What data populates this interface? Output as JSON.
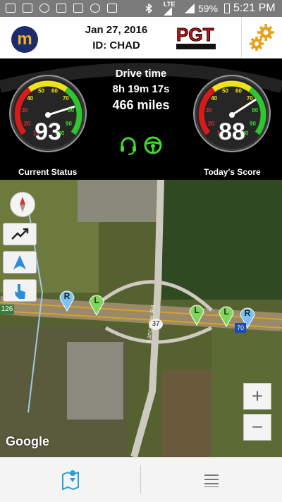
{
  "status_bar": {
    "lte": "LTE",
    "battery": "59%",
    "time": "5:21 PM"
  },
  "header": {
    "logo_letter": "m",
    "date": "Jan 27, 2016",
    "driver_id": "ID: CHAD",
    "brand_text": "PGT"
  },
  "dashboard": {
    "current_status": {
      "label": "Current Status",
      "value": "93",
      "scale": [
        "10",
        "20",
        "30",
        "40",
        "50",
        "60",
        "70",
        "80",
        "90",
        "100"
      ]
    },
    "todays_score": {
      "label": "Today's Score",
      "value": "88",
      "scale": [
        "10",
        "20",
        "30",
        "40",
        "50",
        "60",
        "70",
        "80",
        "90",
        "100"
      ]
    },
    "drive_time_label": "Drive time",
    "drive_time": "8h 19m 17s",
    "miles": "466 miles",
    "icons": [
      "headset-icon",
      "steering-wheel-icon"
    ],
    "accent": "#3ddc2b"
  },
  "map": {
    "attribution": "Google",
    "road_shields": {
      "left": "126",
      "center": "37",
      "interstate": "70"
    },
    "street_label": "Lancaster Rd",
    "markers": [
      "R",
      "L",
      "L",
      "L",
      "R"
    ],
    "zoom_in": "+",
    "zoom_out": "−"
  },
  "bottom_nav": {
    "left_icon": "map-pin-icon",
    "right_icon": "list-icon"
  }
}
